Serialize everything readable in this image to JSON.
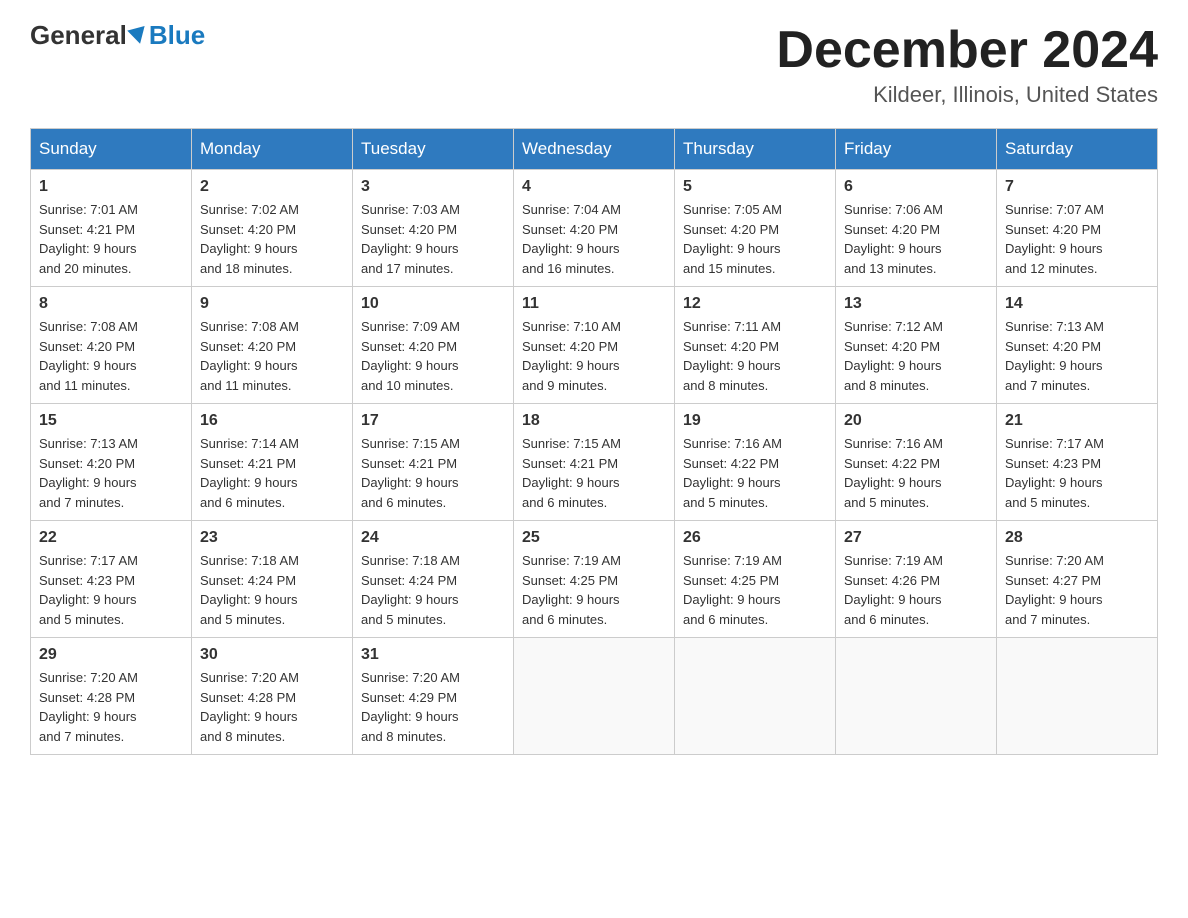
{
  "logo": {
    "general": "General",
    "blue": "Blue"
  },
  "header": {
    "month": "December 2024",
    "location": "Kildeer, Illinois, United States"
  },
  "days": {
    "headers": [
      "Sunday",
      "Monday",
      "Tuesday",
      "Wednesday",
      "Thursday",
      "Friday",
      "Saturday"
    ]
  },
  "weeks": [
    [
      {
        "day": "1",
        "sunrise": "7:01 AM",
        "sunset": "4:21 PM",
        "daylight": "9 hours and 20 minutes."
      },
      {
        "day": "2",
        "sunrise": "7:02 AM",
        "sunset": "4:20 PM",
        "daylight": "9 hours and 18 minutes."
      },
      {
        "day": "3",
        "sunrise": "7:03 AM",
        "sunset": "4:20 PM",
        "daylight": "9 hours and 17 minutes."
      },
      {
        "day": "4",
        "sunrise": "7:04 AM",
        "sunset": "4:20 PM",
        "daylight": "9 hours and 16 minutes."
      },
      {
        "day": "5",
        "sunrise": "7:05 AM",
        "sunset": "4:20 PM",
        "daylight": "9 hours and 15 minutes."
      },
      {
        "day": "6",
        "sunrise": "7:06 AM",
        "sunset": "4:20 PM",
        "daylight": "9 hours and 13 minutes."
      },
      {
        "day": "7",
        "sunrise": "7:07 AM",
        "sunset": "4:20 PM",
        "daylight": "9 hours and 12 minutes."
      }
    ],
    [
      {
        "day": "8",
        "sunrise": "7:08 AM",
        "sunset": "4:20 PM",
        "daylight": "9 hours and 11 minutes."
      },
      {
        "day": "9",
        "sunrise": "7:08 AM",
        "sunset": "4:20 PM",
        "daylight": "9 hours and 11 minutes."
      },
      {
        "day": "10",
        "sunrise": "7:09 AM",
        "sunset": "4:20 PM",
        "daylight": "9 hours and 10 minutes."
      },
      {
        "day": "11",
        "sunrise": "7:10 AM",
        "sunset": "4:20 PM",
        "daylight": "9 hours and 9 minutes."
      },
      {
        "day": "12",
        "sunrise": "7:11 AM",
        "sunset": "4:20 PM",
        "daylight": "9 hours and 8 minutes."
      },
      {
        "day": "13",
        "sunrise": "7:12 AM",
        "sunset": "4:20 PM",
        "daylight": "9 hours and 8 minutes."
      },
      {
        "day": "14",
        "sunrise": "7:13 AM",
        "sunset": "4:20 PM",
        "daylight": "9 hours and 7 minutes."
      }
    ],
    [
      {
        "day": "15",
        "sunrise": "7:13 AM",
        "sunset": "4:20 PM",
        "daylight": "9 hours and 7 minutes."
      },
      {
        "day": "16",
        "sunrise": "7:14 AM",
        "sunset": "4:21 PM",
        "daylight": "9 hours and 6 minutes."
      },
      {
        "day": "17",
        "sunrise": "7:15 AM",
        "sunset": "4:21 PM",
        "daylight": "9 hours and 6 minutes."
      },
      {
        "day": "18",
        "sunrise": "7:15 AM",
        "sunset": "4:21 PM",
        "daylight": "9 hours and 6 minutes."
      },
      {
        "day": "19",
        "sunrise": "7:16 AM",
        "sunset": "4:22 PM",
        "daylight": "9 hours and 5 minutes."
      },
      {
        "day": "20",
        "sunrise": "7:16 AM",
        "sunset": "4:22 PM",
        "daylight": "9 hours and 5 minutes."
      },
      {
        "day": "21",
        "sunrise": "7:17 AM",
        "sunset": "4:23 PM",
        "daylight": "9 hours and 5 minutes."
      }
    ],
    [
      {
        "day": "22",
        "sunrise": "7:17 AM",
        "sunset": "4:23 PM",
        "daylight": "9 hours and 5 minutes."
      },
      {
        "day": "23",
        "sunrise": "7:18 AM",
        "sunset": "4:24 PM",
        "daylight": "9 hours and 5 minutes."
      },
      {
        "day": "24",
        "sunrise": "7:18 AM",
        "sunset": "4:24 PM",
        "daylight": "9 hours and 5 minutes."
      },
      {
        "day": "25",
        "sunrise": "7:19 AM",
        "sunset": "4:25 PM",
        "daylight": "9 hours and 6 minutes."
      },
      {
        "day": "26",
        "sunrise": "7:19 AM",
        "sunset": "4:25 PM",
        "daylight": "9 hours and 6 minutes."
      },
      {
        "day": "27",
        "sunrise": "7:19 AM",
        "sunset": "4:26 PM",
        "daylight": "9 hours and 6 minutes."
      },
      {
        "day": "28",
        "sunrise": "7:20 AM",
        "sunset": "4:27 PM",
        "daylight": "9 hours and 7 minutes."
      }
    ],
    [
      {
        "day": "29",
        "sunrise": "7:20 AM",
        "sunset": "4:28 PM",
        "daylight": "9 hours and 7 minutes."
      },
      {
        "day": "30",
        "sunrise": "7:20 AM",
        "sunset": "4:28 PM",
        "daylight": "9 hours and 8 minutes."
      },
      {
        "day": "31",
        "sunrise": "7:20 AM",
        "sunset": "4:29 PM",
        "daylight": "9 hours and 8 minutes."
      },
      null,
      null,
      null,
      null
    ]
  ]
}
